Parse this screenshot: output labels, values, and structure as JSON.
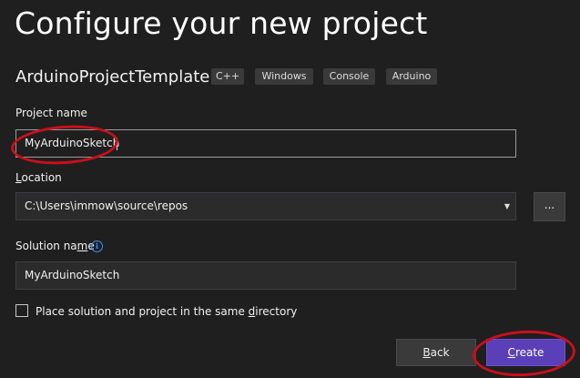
{
  "header": {
    "title": "Configure your new project"
  },
  "template": {
    "name": "ArduinoProjectTemplate",
    "tags": [
      "C++",
      "Windows",
      "Console",
      "Arduino"
    ]
  },
  "project_name": {
    "label": "Project name",
    "value": "MyArduinoSketch"
  },
  "location": {
    "label_underlined": "L",
    "label_rest": "ocation",
    "value": "C:\\Users\\immow\\source\\repos",
    "browse_label": "..."
  },
  "solution_name": {
    "label_before": "Solution na",
    "label_underlined": "m",
    "label_after": "e",
    "value": "MyArduinoSketch",
    "info_icon": "i"
  },
  "same_directory": {
    "label_before": "Place solution and project in the same ",
    "label_underlined": "d",
    "label_after": "irectory",
    "checked": false
  },
  "footer": {
    "back_underlined": "B",
    "back_rest": "ack",
    "create_underlined": "C",
    "create_rest": "reate"
  },
  "colors": {
    "background": "#1f1f1f",
    "accent": "#5b3fb8",
    "annotation": "#c8101a"
  }
}
